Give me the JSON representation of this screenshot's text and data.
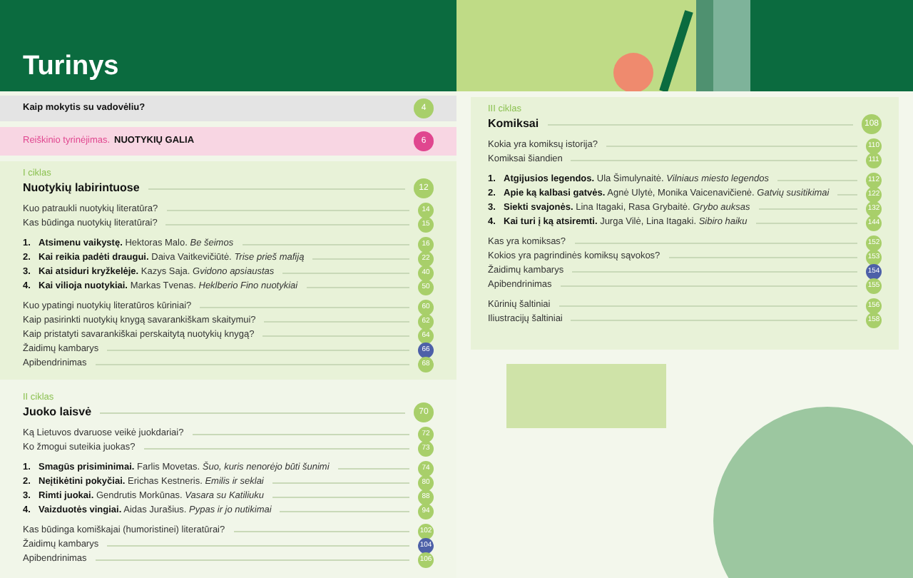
{
  "title": "Turinys",
  "intro": [
    {
      "kind": "plain",
      "text": "Kaip mokytis su vadovėliu?",
      "page": "4"
    },
    {
      "kind": "feature",
      "label": "Reiškinio tyrinėjimas.",
      "text": "NUOTYKIŲ GALIA",
      "page": "6"
    }
  ],
  "sections": [
    {
      "label": "I ciklas",
      "title": "Nuotykių labirintuose",
      "page": "12",
      "groups": [
        [
          {
            "kind": "question",
            "text": "Kuo patraukli nuotykių literatūra?",
            "page": "14"
          },
          {
            "kind": "question",
            "text": "Kas būdinga nuotykių literatūrai?",
            "page": "15"
          }
        ],
        [
          {
            "kind": "story",
            "number": "1.",
            "title": "Atsimenu vaikystę.",
            "author": "Hektoras Malo.",
            "work": "Be šeimos",
            "page": "16"
          },
          {
            "kind": "story",
            "number": "2.",
            "title": "Kai reikia padėti draugui.",
            "author": "Daiva Vaitkevičiūtė.",
            "work": "Trise prieš mafiją",
            "page": "22"
          },
          {
            "kind": "story",
            "number": "3.",
            "title": "Kai atsiduri kryžkelėje.",
            "author": "Kazys Saja.",
            "work": "Gvidono apsiaustas",
            "page": "40"
          },
          {
            "kind": "story",
            "number": "4.",
            "title": "Kai vilioja nuotykiai.",
            "author": "Markas Tvenas.",
            "work": "Heklberio Fino nuotykiai",
            "page": "50"
          }
        ],
        [
          {
            "kind": "question",
            "text": "Kuo ypatingi nuotykių literatūros kūriniai?",
            "page": "60"
          },
          {
            "kind": "question",
            "text": "Kaip pasirinkti nuotykių knygą savarankiškam skaitymui?",
            "page": "62"
          },
          {
            "kind": "question",
            "text": "Kaip pristatyti savarankiškai perskaitytą nuotykių knygą?",
            "page": "64"
          },
          {
            "kind": "game",
            "text": "Žaidimų kambarys",
            "page": "66"
          },
          {
            "kind": "question",
            "text": "Apibendrinimas",
            "page": "68"
          }
        ]
      ]
    },
    {
      "label": "II ciklas",
      "title": "Juoko laisvė",
      "page": "70",
      "groups": [
        [
          {
            "kind": "question",
            "text": "Ką Lietuvos dvaruose veikė juokdariai?",
            "page": "72"
          },
          {
            "kind": "question",
            "text": "Ko žmogui suteikia juokas?",
            "page": "73"
          }
        ],
        [
          {
            "kind": "story",
            "number": "1.",
            "title": "Smagūs prisiminimai.",
            "author": "Farlis Movetas.",
            "work": "Šuo, kuris nenorėjo būti šunimi",
            "page": "74"
          },
          {
            "kind": "story",
            "number": "2.",
            "title": "Neįtikėtini pokyčiai.",
            "author": "Erichas Kestneris.",
            "work": "Emilis ir seklai",
            "page": "80"
          },
          {
            "kind": "story",
            "number": "3.",
            "title": "Rimti juokai.",
            "author": "Gendrutis Morkūnas.",
            "work": "Vasara su Katiliuku",
            "page": "88"
          },
          {
            "kind": "story",
            "number": "4.",
            "title": "Vaizduotės vingiai.",
            "author": "Aidas Jurašius.",
            "work": "Pypas ir jo nutikimai",
            "page": "94"
          }
        ],
        [
          {
            "kind": "question",
            "text": "Kas būdinga komiškajai (humoristinei) literatūrai?",
            "page": "102"
          },
          {
            "kind": "game",
            "text": "Žaidimų kambarys",
            "page": "104"
          },
          {
            "kind": "question",
            "text": "Apibendrinimas",
            "page": "106"
          }
        ]
      ]
    },
    {
      "label": "III ciklas",
      "title": "Komiksai",
      "page": "108",
      "groups": [
        [
          {
            "kind": "question",
            "text": "Kokia yra komiksų istorija?",
            "page": "110"
          },
          {
            "kind": "question",
            "text": "Komiksai šiandien",
            "page": "111"
          }
        ],
        [
          {
            "kind": "story",
            "number": "1.",
            "title": "Atgijusios legendos.",
            "author": "Ula Šimulynaitė.",
            "work": "Vilniaus miesto legendos",
            "page": "112"
          },
          {
            "kind": "story",
            "number": "2.",
            "title": "Apie ką kalbasi gatvės.",
            "author": "Agnė Ulytė, Monika Vaicenavičienė.",
            "work": "Gatvių susitikimai",
            "page": "122"
          },
          {
            "kind": "story",
            "number": "3.",
            "title": "Siekti svajonės.",
            "author": "Lina Itagaki, Rasa Grybaitė.",
            "work": "Grybo auksas",
            "page": "132"
          },
          {
            "kind": "story",
            "number": "4.",
            "title": "Kai turi į ką atsiremti.",
            "author": "Jurga Vilė, Lina Itagaki.",
            "work": "Sibiro haiku",
            "page": "144"
          }
        ],
        [
          {
            "kind": "question",
            "text": "Kas yra komiksas?",
            "page": "152"
          },
          {
            "kind": "question",
            "text": "Kokios yra pagrindinės komiksų sąvokos?",
            "page": "153"
          },
          {
            "kind": "game",
            "text": "Žaidimų kambarys",
            "page": "154"
          },
          {
            "kind": "question",
            "text": "Apibendrinimas",
            "page": "155"
          }
        ],
        [
          {
            "kind": "question",
            "text": "Kūrinių šaltiniai",
            "page": "156"
          },
          {
            "kind": "question",
            "text": "Iliustracijų šaltiniai",
            "page": "158"
          }
        ]
      ]
    }
  ]
}
